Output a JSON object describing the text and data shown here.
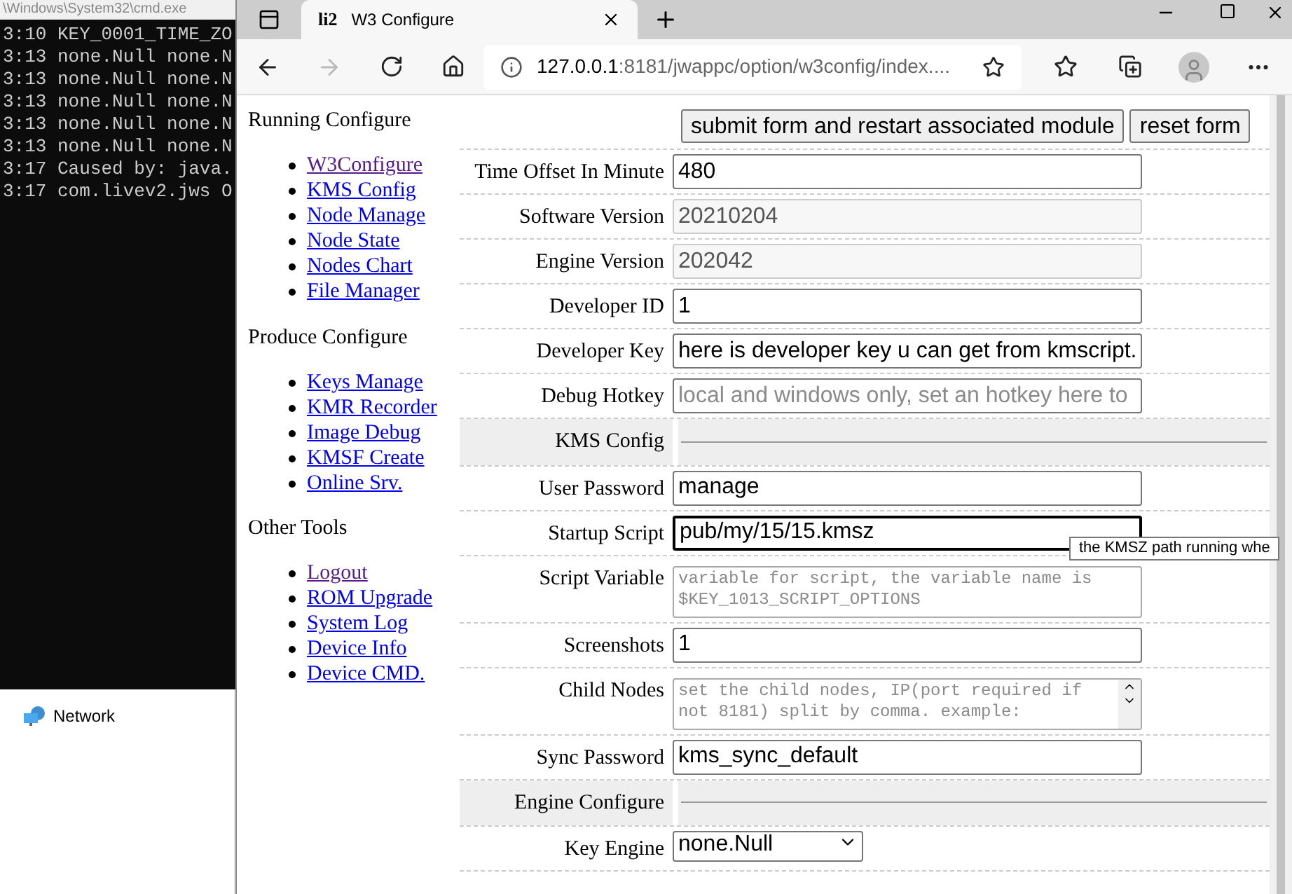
{
  "console": {
    "title": "\\Windows\\System32\\cmd.exe",
    "lines": [
      "3:10 KEY_0001_TIME_ZO",
      "3:13 none.Null none.N",
      "3:13 none.Null none.N",
      "3:13 none.Null none.N",
      "3:13 none.Null none.N",
      "3:13 none.Null none.N",
      "3:17 Caused by: java.",
      "3:17 com.livev2.jws O"
    ]
  },
  "explorer": {
    "items": [
      {
        "label": "Network"
      }
    ]
  },
  "browser": {
    "tab": {
      "favicon_text": "li2",
      "title": "W3 Configure"
    },
    "address": {
      "host": "127.0.0.1",
      "path": ":8181/jwappc/option/w3config/index...."
    }
  },
  "sidebar": {
    "sections": [
      {
        "title": "Running Configure",
        "links": [
          {
            "label": "W3Configure",
            "visited": true
          },
          {
            "label": "KMS Config",
            "visited": false
          },
          {
            "label": "Node Manage",
            "visited": false
          },
          {
            "label": "Node State",
            "visited": false
          },
          {
            "label": "Nodes Chart",
            "visited": false
          },
          {
            "label": "File Manager",
            "visited": false
          }
        ]
      },
      {
        "title": "Produce Configure",
        "links": [
          {
            "label": "Keys Manage",
            "visited": false
          },
          {
            "label": "KMR Recorder",
            "visited": false
          },
          {
            "label": "Image Debug",
            "visited": false
          },
          {
            "label": "KMSF Create",
            "visited": false
          },
          {
            "label": "Online Srv.",
            "visited": false
          }
        ]
      },
      {
        "title": "Other Tools",
        "links": [
          {
            "label": "Logout",
            "visited": true
          },
          {
            "label": "ROM Upgrade",
            "visited": false
          },
          {
            "label": "System Log",
            "visited": false
          },
          {
            "label": "Device Info",
            "visited": false
          },
          {
            "label": "Device CMD.",
            "visited": false
          }
        ]
      }
    ]
  },
  "form": {
    "buttons": [
      "submit form and restart associated module",
      "reset form"
    ],
    "rows": [
      {
        "kind": "input",
        "label": "Time Offset In Minute",
        "value": "480",
        "disabled": false,
        "focused": false
      },
      {
        "kind": "input",
        "label": "Software Version",
        "value": "20210204",
        "disabled": true,
        "focused": false
      },
      {
        "kind": "input",
        "label": "Engine Version",
        "value": "202042",
        "disabled": true,
        "focused": false
      },
      {
        "kind": "input",
        "label": "Developer ID",
        "value": "1",
        "disabled": false,
        "focused": false
      },
      {
        "kind": "input",
        "label": "Developer Key",
        "value": "here is developer key u can get from kmscript.",
        "disabled": false,
        "focused": false
      },
      {
        "kind": "input",
        "label": "Debug Hotkey",
        "placeholder": "local and windows only, set an hotkey here to",
        "disabled": false,
        "focused": false
      },
      {
        "kind": "section",
        "label": "KMS Config"
      },
      {
        "kind": "input",
        "label": "User Password",
        "value": "manage",
        "disabled": false,
        "focused": false
      },
      {
        "kind": "input",
        "label": "Startup Script",
        "value": "pub/my/15/15.kmsz",
        "disabled": false,
        "focused": true,
        "tooltip": "the KMSZ path running whe"
      },
      {
        "kind": "textarea",
        "label": "Script Variable",
        "placeholder": "variable for script, the variable name is\n$KEY_1013_SCRIPT_OPTIONS",
        "scrollable": false
      },
      {
        "kind": "input",
        "label": "Screenshots",
        "value": "1",
        "disabled": false,
        "focused": false
      },
      {
        "kind": "textarea",
        "label": "Child Nodes",
        "placeholder": "set the child nodes, IP(port required if\nnot 8181) split by comma. example:",
        "scrollable": true
      },
      {
        "kind": "input",
        "label": "Sync Password",
        "value": "kms_sync_default",
        "disabled": false,
        "focused": false
      },
      {
        "kind": "section",
        "label": "Engine Configure"
      },
      {
        "kind": "select",
        "label": "Key Engine",
        "value": "none.Null"
      }
    ]
  }
}
